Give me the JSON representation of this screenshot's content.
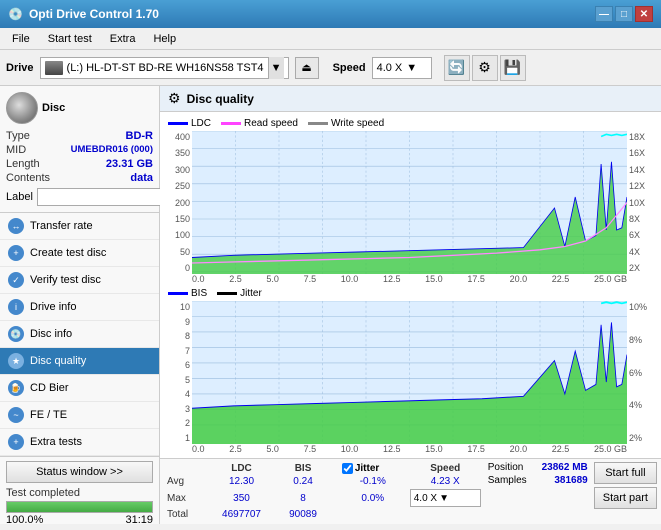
{
  "titlebar": {
    "title": "Opti Drive Control 1.70",
    "icon": "💿",
    "controls": [
      "—",
      "□",
      "✕"
    ]
  },
  "menubar": {
    "items": [
      "File",
      "Start test",
      "Extra",
      "Help"
    ]
  },
  "drivebar": {
    "label": "Drive",
    "drive_text": "(L:)  HL-DT-ST BD-RE  WH16NS58 TST4",
    "speed_label": "Speed",
    "speed_value": "4.0 X"
  },
  "disc": {
    "header": "Disc",
    "type_label": "Type",
    "type_value": "BD-R",
    "mid_label": "MID",
    "mid_value": "UMEBDR016 (000)",
    "length_label": "Length",
    "length_value": "23.31 GB",
    "contents_label": "Contents",
    "contents_value": "data",
    "label_label": "Label"
  },
  "nav": {
    "items": [
      {
        "id": "transfer-rate",
        "label": "Transfer rate",
        "active": false
      },
      {
        "id": "create-test-disc",
        "label": "Create test disc",
        "active": false
      },
      {
        "id": "verify-test-disc",
        "label": "Verify test disc",
        "active": false
      },
      {
        "id": "drive-info",
        "label": "Drive info",
        "active": false
      },
      {
        "id": "disc-info",
        "label": "Disc info",
        "active": false
      },
      {
        "id": "disc-quality",
        "label": "Disc quality",
        "active": true
      },
      {
        "id": "cd-bier",
        "label": "CD Bier",
        "active": false
      },
      {
        "id": "fe-te",
        "label": "FE / TE",
        "active": false
      },
      {
        "id": "extra-tests",
        "label": "Extra tests",
        "active": false
      }
    ]
  },
  "status": {
    "btn_label": "Status window >>",
    "text": "Test completed",
    "progress": 100,
    "time": "31:19"
  },
  "content": {
    "title": "Disc quality"
  },
  "chart1": {
    "legend": [
      {
        "label": "LDC",
        "color": "#0000ff"
      },
      {
        "label": "Read speed",
        "color": "#ff44ff"
      },
      {
        "label": "Write speed",
        "color": "#888888"
      }
    ],
    "y_left": [
      "400",
      "350",
      "300",
      "250",
      "200",
      "150",
      "100",
      "50",
      "0"
    ],
    "y_right": [
      "18X",
      "16X",
      "14X",
      "12X",
      "10X",
      "8X",
      "6X",
      "4X",
      "2X"
    ],
    "x_axis": [
      "0.0",
      "2.5",
      "5.0",
      "7.5",
      "10.0",
      "12.5",
      "15.0",
      "17.5",
      "20.0",
      "22.5",
      "25.0 GB"
    ]
  },
  "chart2": {
    "legend": [
      {
        "label": "BIS",
        "color": "#0000ff"
      },
      {
        "label": "Jitter",
        "color": "#000000"
      }
    ],
    "y_left": [
      "10",
      "9",
      "8",
      "7",
      "6",
      "5",
      "4",
      "3",
      "2",
      "1"
    ],
    "y_right": [
      "10%",
      "8%",
      "6%",
      "4%",
      "2%"
    ],
    "x_axis": [
      "0.0",
      "2.5",
      "5.0",
      "7.5",
      "10.0",
      "12.5",
      "15.0",
      "17.5",
      "20.0",
      "22.5",
      "25.0 GB"
    ]
  },
  "stats": {
    "columns": [
      "",
      "LDC",
      "BIS",
      "",
      "Jitter",
      "Speed"
    ],
    "rows": [
      {
        "label": "Avg",
        "ldc": "12.30",
        "bis": "0.24",
        "jitter": "-0.1%",
        "speed": ""
      },
      {
        "label": "Max",
        "ldc": "350",
        "bis": "8",
        "jitter": "0.0%",
        "speed": ""
      },
      {
        "label": "Total",
        "ldc": "4697707",
        "bis": "90089",
        "jitter": "",
        "speed": ""
      }
    ],
    "jitter_checked": true,
    "jitter_label": "Jitter",
    "speed_display": "4.23 X",
    "speed_select": "4.0 X",
    "position_label": "Position",
    "position_value": "23862 MB",
    "samples_label": "Samples",
    "samples_value": "381689",
    "btn_start_full": "Start full",
    "btn_start_part": "Start part"
  }
}
